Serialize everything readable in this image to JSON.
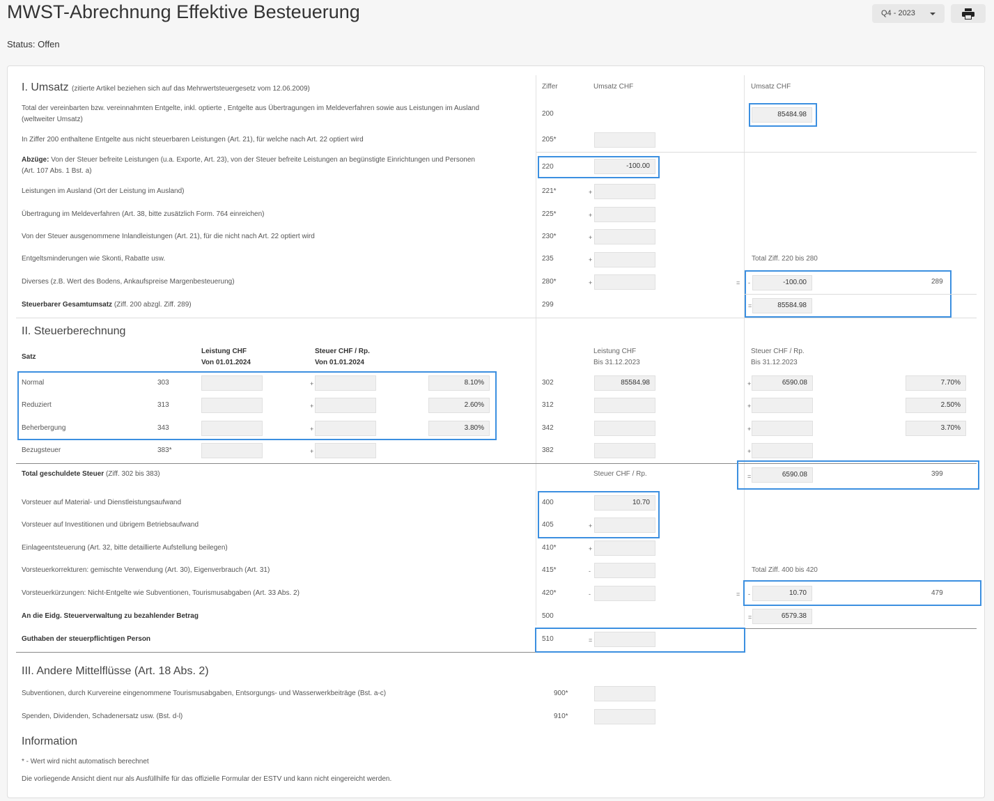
{
  "header": {
    "title": "MWST-Abrechnung Effektive Besteuerung",
    "status": "Status: Offen",
    "period": "Q4 - 2023"
  },
  "umsatz": {
    "heading": "I. Umsatz",
    "note": "(zitierte Artikel beziehen sich auf das Mehrwertsteuergesetz vom 12.06.2009)",
    "col_ziffer": "Ziffer",
    "col_umsatz1": "Umsatz CHF",
    "col_umsatz2": "Umsatz CHF",
    "r200": {
      "label": "Total der vereinbarten bzw. vereinnahmten Entgelte, inkl. optierte , Entgelte aus Übertragungen im Meldeverfahren sowie aus Leistungen im Ausland",
      "label2": "(weltweiter Umsatz)",
      "code": "200",
      "value": "85484.98"
    },
    "r205": {
      "label": "In Ziffer 200 enthaltene Entgelte aus nicht steuerbaren Leistungen (Art. 21), für welche nach Art. 22 optiert wird",
      "code": "205*",
      "value": ""
    },
    "r220": {
      "label_bold": "Abzüge:",
      "label": "Von der Steuer befreite Leistungen (u.a. Exporte, Art. 23), von der Steuer befreite Leistungen an begünstigte Einrichtungen und Personen",
      "label2": "(Art. 107 Abs. 1 Bst. a)",
      "code": "220",
      "value": "-100.00"
    },
    "r221": {
      "label": "Leistungen im Ausland (Ort der Leistung im Ausland)",
      "code": "221*",
      "op": "+",
      "value": ""
    },
    "r225": {
      "label": "Übertragung im Meldeverfahren (Art. 38, bitte zusätzlich Form. 764 einreichen)",
      "code": "225*",
      "op": "+",
      "value": ""
    },
    "r230": {
      "label": "Von der Steuer ausgenommene Inlandleistungen (Art. 21), für die nicht nach Art. 22 optiert wird",
      "code": "230*",
      "op": "+",
      "value": ""
    },
    "r235": {
      "label": "Entgeltsminderungen wie Skonti, Rabatte usw.",
      "code": "235",
      "op": "+",
      "value": "",
      "total_note": "Total Ziff. 220 bis 280"
    },
    "r280": {
      "label": "Diverses (z.B. Wert des Bodens, Ankaufspreise Margenbesteuerung)",
      "code": "280*",
      "op": "+",
      "value": "",
      "eq": "=",
      "minus": "-",
      "total": "-100.00",
      "total_code": "289"
    },
    "r299": {
      "label_bold": "Steuerbarer Gesamtumsatz",
      "label": "(Ziff. 200 abzgl. Ziff. 289)",
      "code": "299",
      "eq": "=",
      "total": "85584.98"
    }
  },
  "steuer": {
    "heading": "II. Steuerberechnung",
    "satz": "Satz",
    "col_leistung_neu": "Leistung CHF",
    "col_leistung_neu_sub": "Von 01.01.2024",
    "col_steuer_neu": "Steuer CHF / Rp.",
    "col_steuer_neu_sub": "Von 01.01.2024",
    "col_leistung_alt": "Leistung CHF",
    "col_leistung_alt_sub": "Bis 31.12.2023",
    "col_steuer_alt": "Steuer CHF / Rp.",
    "col_steuer_alt_sub": "Bis 31.12.2023",
    "rows": [
      {
        "label": "Normal",
        "code_new": "303",
        "rate_new": "8.10%",
        "code_old": "302",
        "leistung_old": "85584.98",
        "steuer_old": "6590.08",
        "rate_old": "7.70%"
      },
      {
        "label": "Reduziert",
        "code_new": "313",
        "rate_new": "2.60%",
        "code_old": "312",
        "leistung_old": "",
        "steuer_old": "",
        "rate_old": "2.50%"
      },
      {
        "label": "Beherbergung",
        "code_new": "343",
        "rate_new": "3.80%",
        "code_old": "342",
        "leistung_old": "",
        "steuer_old": "",
        "rate_old": "3.70%"
      },
      {
        "label": "Bezugsteuer",
        "code_new": "383*",
        "rate_new": "",
        "code_old": "382",
        "leistung_old": "",
        "steuer_old": "",
        "rate_old": ""
      }
    ],
    "plus": "+",
    "total_label_bold": "Total geschuldete Steuer",
    "total_label": "(Ziff. 302 bis 383)",
    "total_col": "Steuer CHF / Rp.",
    "total_eq": "=",
    "total_value": "6590.08",
    "total_code": "399",
    "r400": {
      "label": "Vorsteuer auf Material- und Dienstleistungsaufwand",
      "code": "400",
      "value": "10.70"
    },
    "r405": {
      "label": "Vorsteuer auf Investitionen und übrigem Betriebsaufwand",
      "code": "405",
      "op": "+",
      "value": ""
    },
    "r410": {
      "label": "Einlageentsteuerung (Art. 32, bitte detaillierte Aufstellung beilegen)",
      "code": "410*",
      "op": "+",
      "value": ""
    },
    "r415": {
      "label": "Vorsteuerkorrekturen: gemischte Verwendung (Art. 30), Eigenverbrauch (Art. 31)",
      "code": "415*",
      "op": "-",
      "value": "",
      "total_note": "Total Ziff. 400 bis 420"
    },
    "r420": {
      "label": "Vorsteuerkürzungen: Nicht-Entgelte wie Subventionen, Tourismusabgaben (Art. 33 Abs. 2)",
      "code": "420*",
      "op": "-",
      "value": "",
      "eq": "=",
      "minus": "-",
      "total": "10.70",
      "total_code": "479"
    },
    "r500": {
      "label_bold": "An die Eidg. Steuerverwaltung zu bezahlender Betrag",
      "code": "500",
      "eq": "=",
      "total": "6579.38"
    },
    "r510": {
      "label_bold": "Guthaben der steuerpflichtigen Person",
      "code": "510",
      "eq": "=",
      "value": ""
    }
  },
  "andere": {
    "heading": "III. Andere Mittelflüsse (Art. 18 Abs. 2)",
    "r900": {
      "label": "Subventionen, durch Kurvereine eingenommene Tourismusabgaben, Entsorgungs- und Wasserwerkbeiträge (Bst. a-c)",
      "code": "900*",
      "value": ""
    },
    "r910": {
      "label": "Spenden, Dividenden, Schadenersatz usw. (Bst. d-l)",
      "code": "910*",
      "value": ""
    }
  },
  "info": {
    "heading": "Information",
    "line1": "* - Wert wird nicht automatisch berechnet",
    "line2": "Die vorliegende Ansicht dient nur als Ausfüllhilfe für das offizielle Formular der ESTV und kann nicht eingereicht werden."
  },
  "icons": {
    "print": "printer-icon",
    "caret": "caret-down-icon"
  },
  "colors": {
    "highlight": "#3b8fe0",
    "field_bg": "#f0f0f0"
  }
}
